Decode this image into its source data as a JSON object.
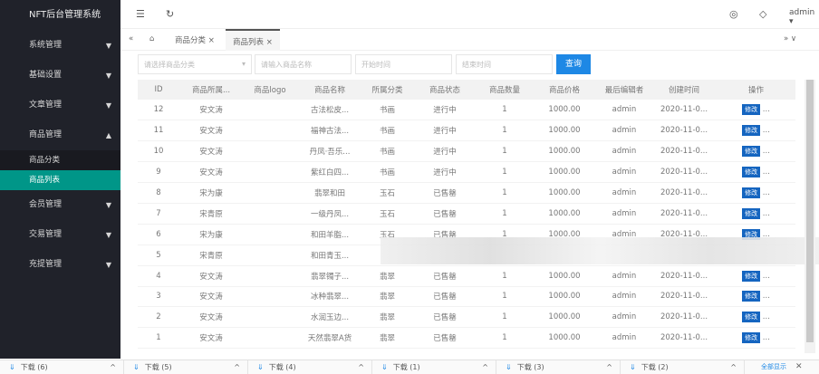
{
  "app": {
    "title": "NFT后台管理系统",
    "user": "admin"
  },
  "sidebar": {
    "items": [
      {
        "label": "系统管理"
      },
      {
        "label": "基础设置"
      },
      {
        "label": "文章管理"
      },
      {
        "label": "商品管理",
        "subs": [
          "商品分类",
          "商品列表"
        ]
      },
      {
        "label": "会员管理"
      },
      {
        "label": "交易管理"
      },
      {
        "label": "充提管理"
      }
    ]
  },
  "tabs": [
    {
      "label": "商品分类"
    },
    {
      "label": "商品列表"
    }
  ],
  "filters": {
    "category": "请选择商品分类",
    "name": "请输入商品名称",
    "start": "开始时间",
    "end": "结束时间",
    "search": "查询"
  },
  "table": {
    "headers": [
      "ID",
      "商品所属...",
      "商品logo",
      "商品名称",
      "所属分类",
      "商品状态",
      "商品数量",
      "商品价格",
      "最后编辑者",
      "创建时间",
      "操作"
    ],
    "rows": [
      [
        "12",
        "安文涛",
        "",
        "古法松皮...",
        "书画",
        "进行中",
        "1",
        "1000.00",
        "admin",
        "2020-11-0..."
      ],
      [
        "11",
        "安文涛",
        "",
        "福神古法...",
        "书画",
        "进行中",
        "1",
        "1000.00",
        "admin",
        "2020-11-0..."
      ],
      [
        "10",
        "安文涛",
        "",
        "丹凤·吾乐...",
        "书画",
        "进行中",
        "1",
        "1000.00",
        "admin",
        "2020-11-0..."
      ],
      [
        "9",
        "安文涛",
        "",
        "紫红白四...",
        "书画",
        "进行中",
        "1",
        "1000.00",
        "admin",
        "2020-11-0..."
      ],
      [
        "8",
        "宋为康",
        "",
        "翡翠和田",
        "玉石",
        "已售罄",
        "1",
        "1000.00",
        "admin",
        "2020-11-0..."
      ],
      [
        "7",
        "宋青原",
        "",
        "一级丹凤...",
        "玉石",
        "已售罄",
        "1",
        "1000.00",
        "admin",
        "2020-11-0..."
      ],
      [
        "6",
        "宋为康",
        "",
        "和田羊脂...",
        "玉石",
        "已售罄",
        "1",
        "1000.00",
        "admin",
        "2020-11-0..."
      ],
      [
        "5",
        "宋青原",
        "",
        "和田青玉...",
        "",
        "",
        "",
        "",
        "",
        "",
        ""
      ],
      [
        "4",
        "安文涛",
        "",
        "翡翠镯子...",
        "翡翠",
        "已售罄",
        "1",
        "1000.00",
        "admin",
        "2020-11-0..."
      ],
      [
        "3",
        "安文涛",
        "",
        "冰种翡翠...",
        "翡翠",
        "已售罄",
        "1",
        "1000.00",
        "admin",
        "2020-11-0..."
      ],
      [
        "2",
        "安文涛",
        "",
        "水润玉边...",
        "翡翠",
        "已售罄",
        "1",
        "1000.00",
        "admin",
        "2020-11-0..."
      ],
      [
        "1",
        "安文涛",
        "",
        "天然翡翠A货",
        "翡翠",
        "已售罄",
        "1",
        "1000.00",
        "admin",
        "2020-11-0..."
      ]
    ],
    "edit": "修改",
    "more": "..."
  },
  "downloads": [
    "下载 (6)",
    "下载 (5)",
    "下载 (4)",
    "下载 (1)",
    "下载 (3)",
    "下载 (2)"
  ],
  "show_all": "全部显示"
}
